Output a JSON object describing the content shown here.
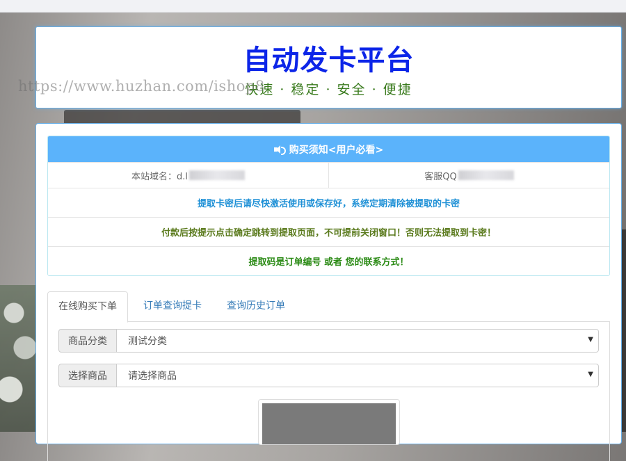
{
  "header": {
    "title": "自动发卡平台",
    "slogan": "快速 · 稳定 · 安全 · 便捷",
    "watermark": "https://www.huzhan.com/ishop8"
  },
  "notice": {
    "heading": "购买须知<用户必看>",
    "domain_label": "本站域名：d.l",
    "service_label": "客服QQ",
    "lines": [
      {
        "text": "提取卡密后请尽快激活使用或保存好，系统定期清除被提取的卡密",
        "color": "#1e90d6"
      },
      {
        "text": "付款后按提示点击确定跳转到提取页面，不可提前关闭窗口！否则无法提取到卡密！",
        "color": "#5a7a1c"
      },
      {
        "text": "提取码是订单编号 或者 您的联系方式！",
        "color": "#2a8a14"
      }
    ]
  },
  "tabs": [
    {
      "label": "在线购买下单",
      "active": true
    },
    {
      "label": "订单查询提卡",
      "active": false
    },
    {
      "label": "查询历史订单",
      "active": false
    }
  ],
  "form": {
    "category_label": "商品分类",
    "category_value": "测试分类",
    "product_label": "选择商品",
    "product_value": "请选择商品"
  },
  "colors": {
    "accent": "#5bb3fb",
    "title_blue": "#0c25e8",
    "slogan_green": "#3a7b1e",
    "border_blue": "#66afe9"
  }
}
